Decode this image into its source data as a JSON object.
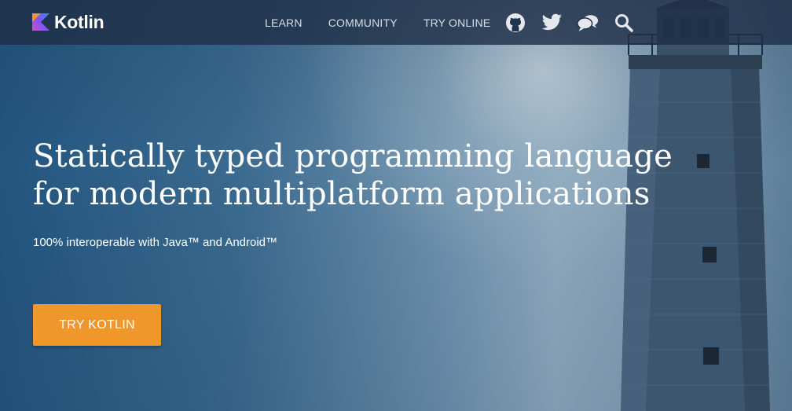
{
  "brand": {
    "name": "Kotlin",
    "colors": {
      "orange": "#f0972c",
      "purple": "#7f52ff",
      "blue": "#3f8ce6"
    }
  },
  "nav": {
    "links": [
      {
        "label": "LEARN"
      },
      {
        "label": "COMMUNITY"
      },
      {
        "label": "TRY ONLINE"
      }
    ],
    "icons": [
      "github-icon",
      "twitter-icon",
      "chat-icon",
      "search-icon"
    ]
  },
  "hero": {
    "headline": "Statically typed programming language for modern multiplatform applications",
    "subtitle": "100% interoperable with Java™ and Android™",
    "cta_label": "TRY KOTLIN",
    "cta_color": "#f0972c"
  }
}
